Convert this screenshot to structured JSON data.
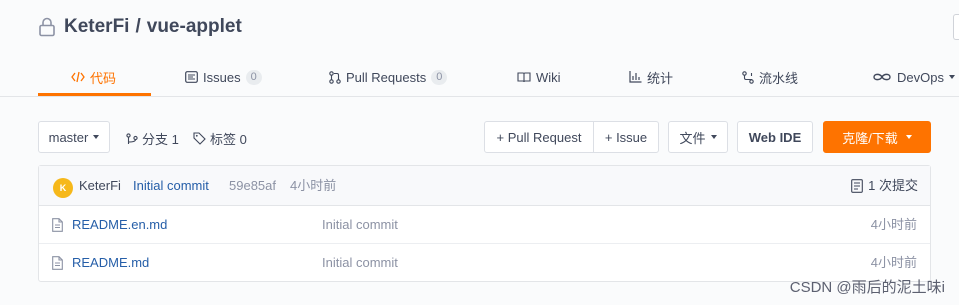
{
  "repo": {
    "owner": "KeterFi",
    "separator": "/",
    "name": "vue-applet"
  },
  "tabs": [
    {
      "label": "代码",
      "icon": "code-icon",
      "active": true
    },
    {
      "label": "Issues",
      "icon": "issues-icon",
      "count": "0"
    },
    {
      "label": "Pull Requests",
      "icon": "pull-request-icon",
      "count": "0"
    },
    {
      "label": "Wiki",
      "icon": "wiki-book-icon"
    },
    {
      "label": "统计",
      "icon": "stats-chart-icon"
    },
    {
      "label": "流水线",
      "icon": "pipeline-icon"
    },
    {
      "label": "DevOps",
      "icon": "infinity-icon",
      "has_dropdown": true
    }
  ],
  "toolbar": {
    "branch": "master",
    "branches_label": "分支 1",
    "tags_label": "标签 0",
    "pull_request_label": "+ Pull Request",
    "issue_label": "+ Issue",
    "files_label": "文件",
    "webide_label": "Web IDE",
    "clone_label": "克隆/下载"
  },
  "commit": {
    "avatar_letter": "K",
    "author": "KeterFi",
    "message": "Initial commit",
    "hash": "59e85af",
    "time": "4小时前",
    "commit_count_label": "1 次提交"
  },
  "files": [
    {
      "name": "README.en.md",
      "message": "Initial commit",
      "time": "4小时前",
      "icon": "file-icon"
    },
    {
      "name": "README.md",
      "message": "Initial commit",
      "time": "4小时前",
      "icon": "file-icon"
    }
  ],
  "watermark": "CSDN @雨后的泥土味i",
  "colors": {
    "accent": "#fe7300",
    "link": "#255ea8",
    "avatar": "#f6b81a"
  }
}
